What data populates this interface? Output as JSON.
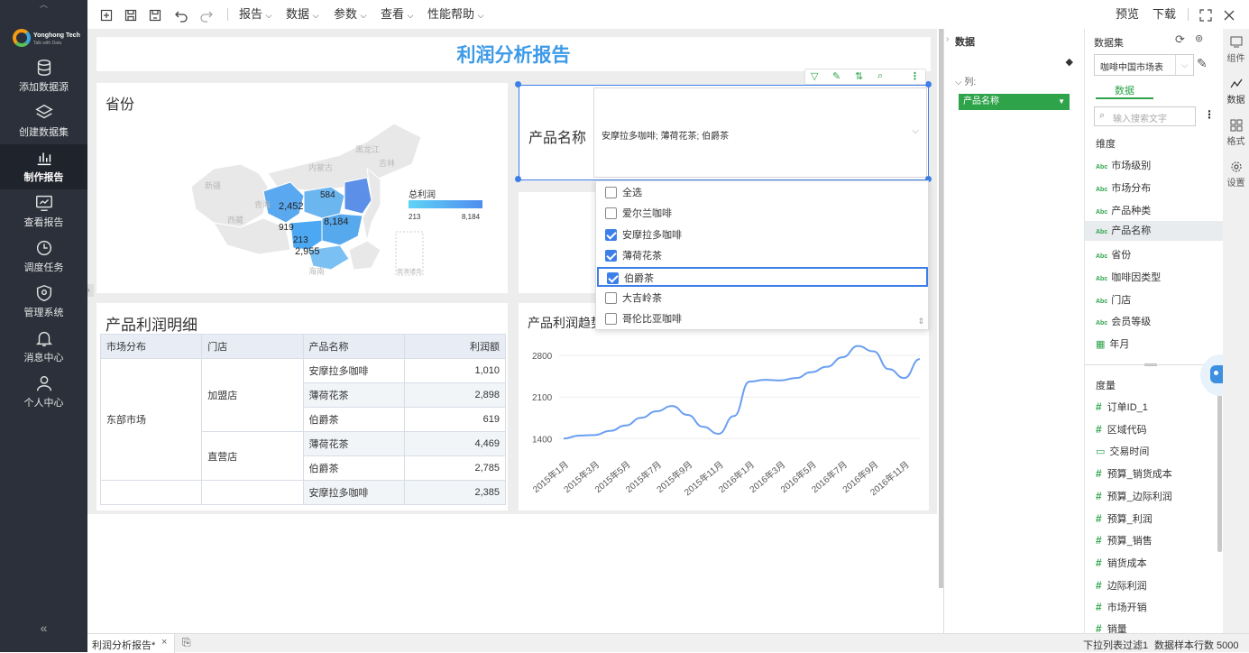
{
  "app": {
    "logo_text": "Yonghong Tech",
    "logo_sub": "Talk with Data"
  },
  "nav": {
    "items": [
      {
        "label": "添加数据源",
        "icon": "database-icon"
      },
      {
        "label": "创建数据集",
        "icon": "layers-icon"
      },
      {
        "label": "制作报告",
        "icon": "bar-chart-icon"
      },
      {
        "label": "查看报告",
        "icon": "view-report-icon"
      },
      {
        "label": "调度任务",
        "icon": "clock-icon"
      },
      {
        "label": "管理系统",
        "icon": "shield-icon"
      },
      {
        "label": "消息中心",
        "icon": "bell-icon"
      },
      {
        "label": "个人中心",
        "icon": "user-icon"
      }
    ],
    "collapse": "«"
  },
  "toolbar": {
    "menus": [
      "报告",
      "数据",
      "参数",
      "查看",
      "性能帮助"
    ],
    "preview": "预览",
    "download": "下载"
  },
  "report": {
    "title": "利润分析报告",
    "map": {
      "title": "省份",
      "legend_title": "总利润",
      "legend_min": "213",
      "legend_max": "8,184",
      "labels": [
        "584",
        "2,452",
        "8,184",
        "919",
        "213",
        "2,955"
      ],
      "regions": [
        "黑龙江",
        "吉林",
        "内蒙古",
        "新疆",
        "青海",
        "西藏",
        "海南",
        "南海诸岛"
      ]
    },
    "filter": {
      "label": "产品名称",
      "value": "安摩拉多咖啡; 薄荷花茶; 伯爵茶",
      "options": [
        {
          "label": "全选",
          "checked": false
        },
        {
          "label": "爱尔兰咖啡",
          "checked": false
        },
        {
          "label": "安摩拉多咖啡",
          "checked": true
        },
        {
          "label": "薄荷花茶",
          "checked": true
        },
        {
          "label": "伯爵茶",
          "checked": true
        },
        {
          "label": "大吉岭茶",
          "checked": false
        },
        {
          "label": "哥伦比亚咖啡",
          "checked": false
        }
      ]
    },
    "table": {
      "title": "产品利润明细",
      "headers": [
        "市场分布",
        "门店",
        "产品名称",
        "利润额"
      ],
      "market": "东部市场",
      "store1": "加盟店",
      "store2": "直营店",
      "rows": [
        {
          "product": "安摩拉多咖啡",
          "profit": "1,010"
        },
        {
          "product": "薄荷花茶",
          "profit": "2,898"
        },
        {
          "product": "伯爵茶",
          "profit": "619"
        },
        {
          "product": "薄荷花茶",
          "profit": "4,469"
        },
        {
          "product": "伯爵茶",
          "profit": "2,785"
        },
        {
          "product": "安摩拉多咖啡",
          "profit": "2,385"
        }
      ]
    }
  },
  "chart_data": {
    "type": "line",
    "title": "产品利润趋势",
    "x": [
      "2015年1月",
      "2015年2月",
      "2015年3月",
      "2015年4月",
      "2015年5月",
      "2015年6月",
      "2015年7月",
      "2015年8月",
      "2015年9月",
      "2015年10月",
      "2015年11月",
      "2015年12月",
      "2016年1月",
      "2016年2月",
      "2016年3月",
      "2016年4月",
      "2016年5月",
      "2016年6月",
      "2016年7月",
      "2016年8月",
      "2016年9月",
      "2016年10月",
      "2016年11月",
      "2016年12月"
    ],
    "xticks": [
      "2015年1月",
      "2015年3月",
      "2015年5月",
      "2015年7月",
      "2015年9月",
      "2015年11月",
      "2016年1月",
      "2016年3月",
      "2016年5月",
      "2016年7月",
      "2016年9月",
      "2016年11月"
    ],
    "values": [
      1400,
      1450,
      1460,
      1530,
      1620,
      1750,
      1860,
      1950,
      1800,
      1600,
      1480,
      1780,
      2360,
      2390,
      2380,
      2420,
      2520,
      2610,
      2770,
      2960,
      2870,
      2570,
      2420,
      2740
    ],
    "yticks": [
      "2800",
      "2100",
      "1400"
    ],
    "ylim": [
      1100,
      3000
    ],
    "grid": true,
    "color": "#6a9ff0"
  },
  "panel": {
    "data_title": "数据",
    "column_label": "列:",
    "column_chip": "产品名称",
    "dataset_title": "数据集",
    "dataset_value": "咖啡中国市场表",
    "tab_data": "数据",
    "search_placeholder": "输入搜索文字",
    "dim_title": "维度",
    "dims": [
      "市场级别",
      "市场分布",
      "产品种类",
      "产品名称",
      "省份",
      "咖啡因类型",
      "门店",
      "会员等级",
      "年月"
    ],
    "measure_title": "度量",
    "measures": [
      "订单ID_1",
      "区域代码",
      "交易时间",
      "预算_销货成本",
      "预算_边际利润",
      "预算_利润",
      "预算_销售",
      "销货成本",
      "边际利润",
      "市场开销",
      "销量"
    ]
  },
  "rtabs": [
    "组件",
    "数据",
    "格式",
    "设置"
  ],
  "status": {
    "tab": "利润分析报告*",
    "filter": "下拉列表过滤1",
    "sample": "数据样本行数 5000"
  },
  "colors": {
    "accent": "#3d9ae8",
    "green": "#2ea34a",
    "nav_bg": "#2b303a"
  }
}
